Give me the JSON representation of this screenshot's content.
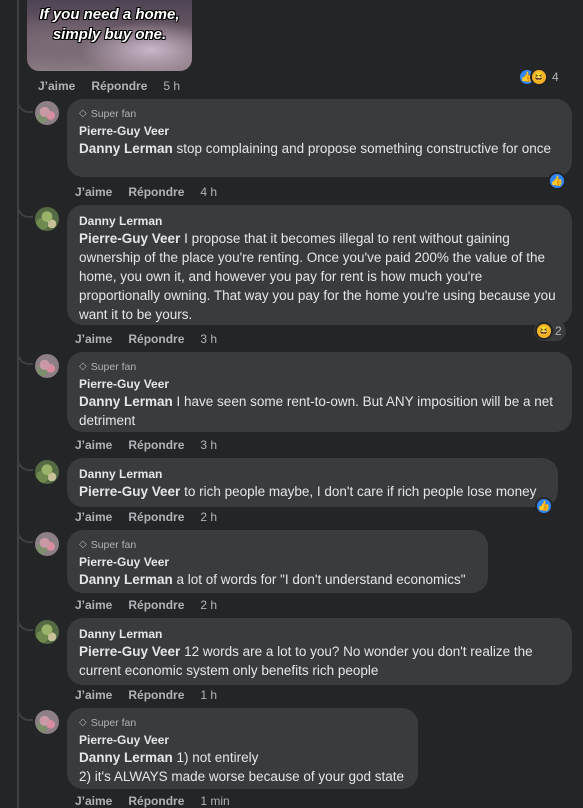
{
  "meme": {
    "line1": "If you need a home,",
    "line2": "simply buy one."
  },
  "top_actions": {
    "like": "J’aime",
    "reply": "Répondre",
    "time": "5 h"
  },
  "top_reaction_count": "4",
  "comments": [
    {
      "badge": "Super fan",
      "author": "Pierre-Guy Veer",
      "mention": "Danny Lerman",
      "text": " stop complaining and propose something constructive for once",
      "like": "J’aime",
      "reply": "Répondre",
      "time": "4 h"
    },
    {
      "author": "Danny Lerman",
      "mention": "Pierre-Guy Veer",
      "text": " I propose that it becomes illegal to rent without gaining ownership of the place you're renting. Once you've paid 200% the value of the home, you own it, and however you pay for rent is how much you're proportionally owning. That way you pay for the home you're using because you want it to be yours.",
      "like": "J’aime",
      "reply": "Répondre",
      "time": "3 h",
      "reaction_count": "2"
    },
    {
      "badge": "Super fan",
      "author": "Pierre-Guy Veer",
      "mention": "Danny Lerman",
      "text": " I have seen some rent-to-own. But ANY imposition will be a net detriment",
      "like": "J’aime",
      "reply": "Répondre",
      "time": "3 h"
    },
    {
      "author": "Danny Lerman",
      "mention": "Pierre-Guy Veer",
      "text": " to rich people maybe, I don't care if rich people lose money",
      "like": "J’aime",
      "reply": "Répondre",
      "time": "2 h"
    },
    {
      "badge": "Super fan",
      "author": "Pierre-Guy Veer",
      "mention": "Danny Lerman",
      "text": " a lot of words for \"I don't understand economics\"",
      "like": "J’aime",
      "reply": "Répondre",
      "time": "2 h"
    },
    {
      "author": "Danny Lerman",
      "mention": "Pierre-Guy Veer",
      "text": " 12 words are a lot to you? No wonder you don't realize the current economic system only benefits rich people",
      "like": "J’aime",
      "reply": "Répondre",
      "time": "1 h"
    },
    {
      "badge": "Super fan",
      "author": "Pierre-Guy Veer",
      "mention": "Danny Lerman",
      "text": " 1) not entirely",
      "text2": "2) it's ALWAYS made worse because of your god state",
      "like": "J’aime",
      "reply": "Répondre",
      "time": "1 min"
    }
  ],
  "icons": {
    "like": "like-reaction-icon",
    "haha": "haha-reaction-icon",
    "badge": "diamond-icon"
  },
  "colors": {
    "background": "#242526",
    "bubble": "#3a3b3c",
    "text": "#e4e6eb",
    "secondary": "#b0b3b8",
    "like_blue": "#2d88ff",
    "haha_yellow": "#f7b125"
  }
}
